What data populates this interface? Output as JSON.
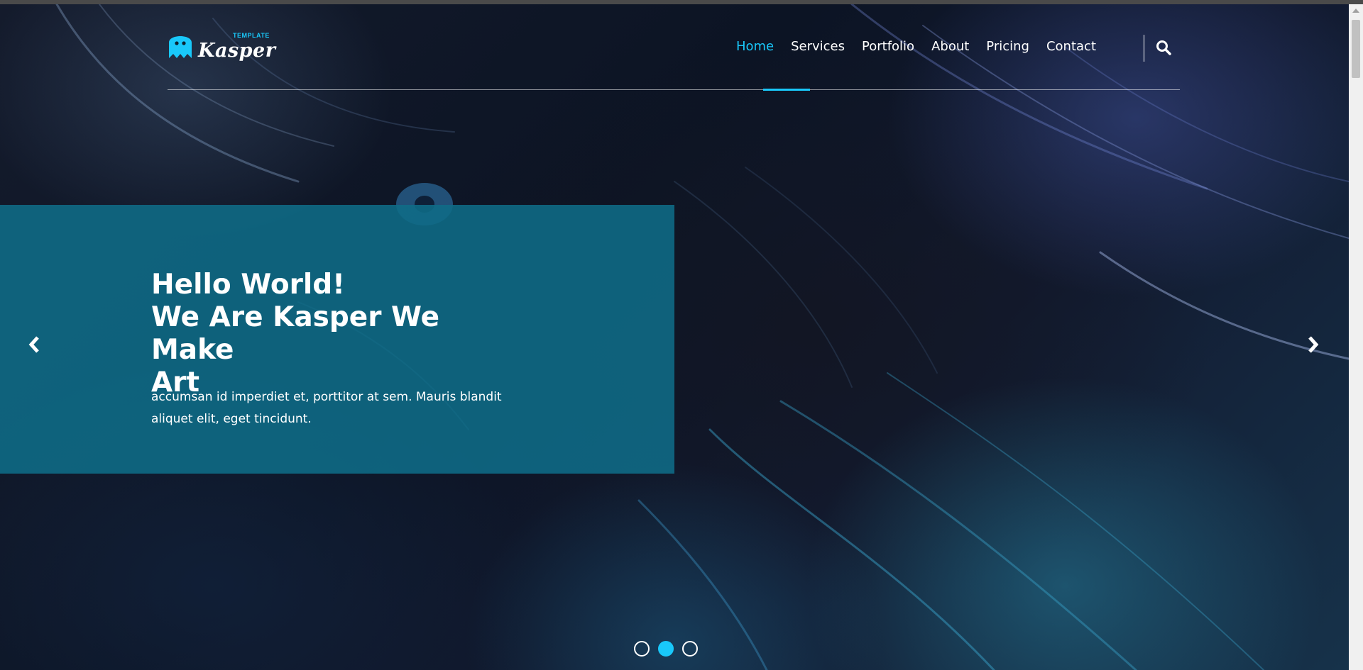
{
  "brand": {
    "name": "Kasper",
    "tag": "TEMPLATE",
    "accent_color": "#19c8fa"
  },
  "nav": {
    "items": [
      {
        "label": "Home",
        "active": true
      },
      {
        "label": "Services",
        "active": false
      },
      {
        "label": "Portfolio",
        "active": false
      },
      {
        "label": "About",
        "active": false
      },
      {
        "label": "Pricing",
        "active": false
      },
      {
        "label": "Contact",
        "active": false
      }
    ],
    "search_icon": "search-icon"
  },
  "hero": {
    "title_line1": "Hello World!",
    "title_line2": "We Are Kasper We Make",
    "title_line3": "Art",
    "text_line1": "accumsan id imperdiet et, porttitor at sem. Mauris blandit",
    "text_line2": "aliquet elit, eget tincidunt.",
    "caption_color": "#0f6c87",
    "prev_icon": "chevron-left-icon",
    "next_icon": "chevron-right-icon"
  },
  "carousel": {
    "slides": 3,
    "active_index": 1
  }
}
